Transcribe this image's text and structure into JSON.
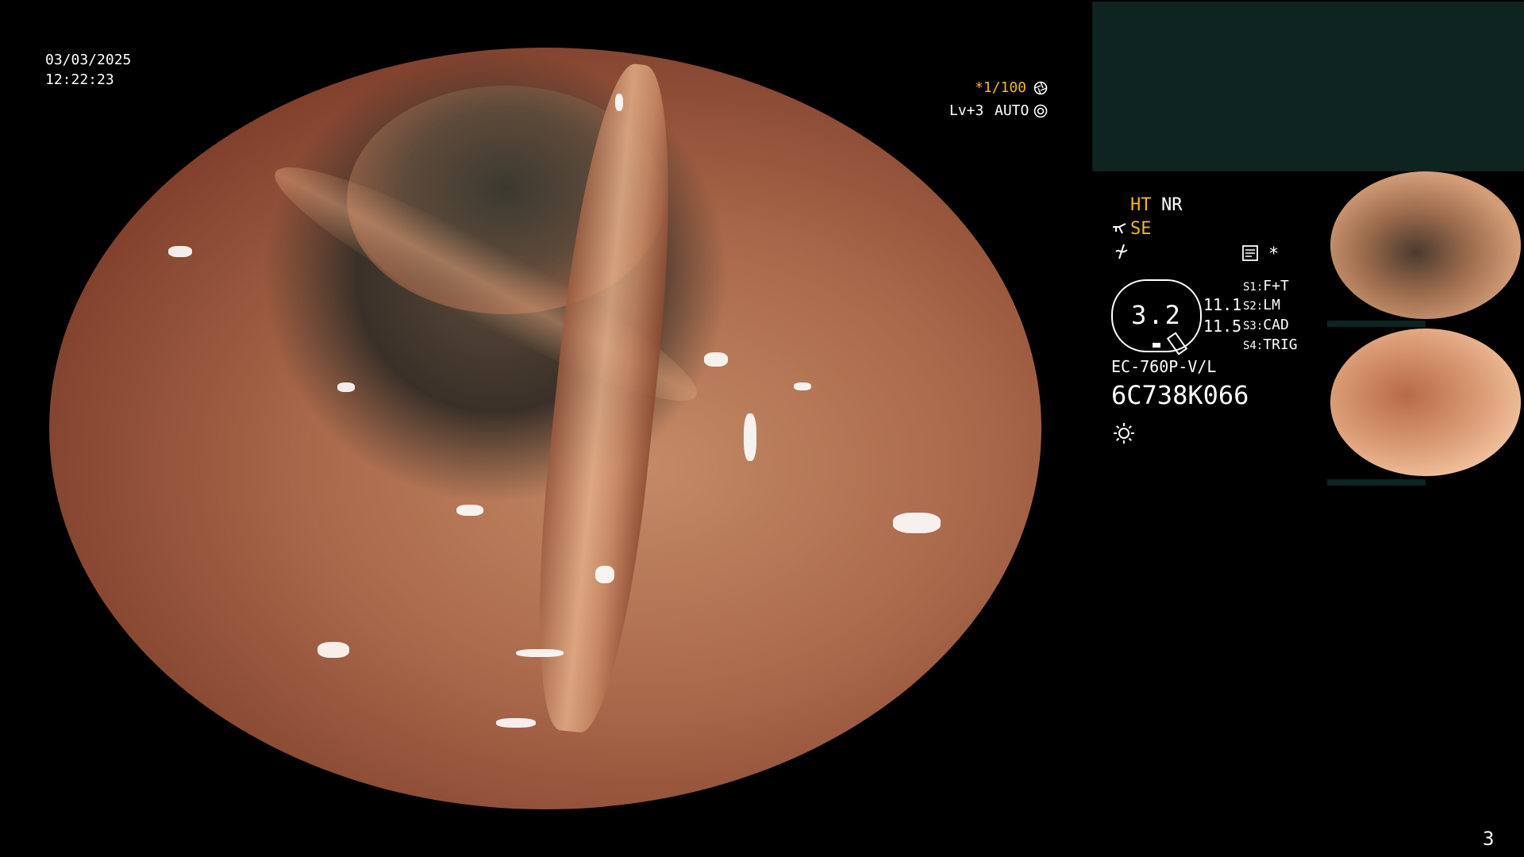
{
  "header": {
    "date": "03/03/2025",
    "time": "12:22:23"
  },
  "exposure": {
    "shutter": "*1/100",
    "level": "Lv+3",
    "mode": "AUTO"
  },
  "settings": {
    "ht": "HT",
    "nr": "NR",
    "se": "SE",
    "magnification": "3.2",
    "values": [
      "11.1",
      "11.5"
    ],
    "slots": [
      {
        "key": "S1:",
        "label": "F+T"
      },
      {
        "key": "S2:",
        "label": "LM"
      },
      {
        "key": "S3:",
        "label": "CAD"
      },
      {
        "key": "S4:",
        "label": "TRIG"
      }
    ],
    "scope_model": "EC-760P-V/L",
    "serial": "6C738K066",
    "asterisk": "*"
  },
  "page_number": "3",
  "colors": {
    "highlight": "#f6b52b",
    "panel": "#0d2420"
  },
  "icons": [
    "aperture-icon",
    "camera-auto-icon",
    "scope-icon",
    "freeze-icon",
    "memo-icon",
    "light-icon"
  ]
}
